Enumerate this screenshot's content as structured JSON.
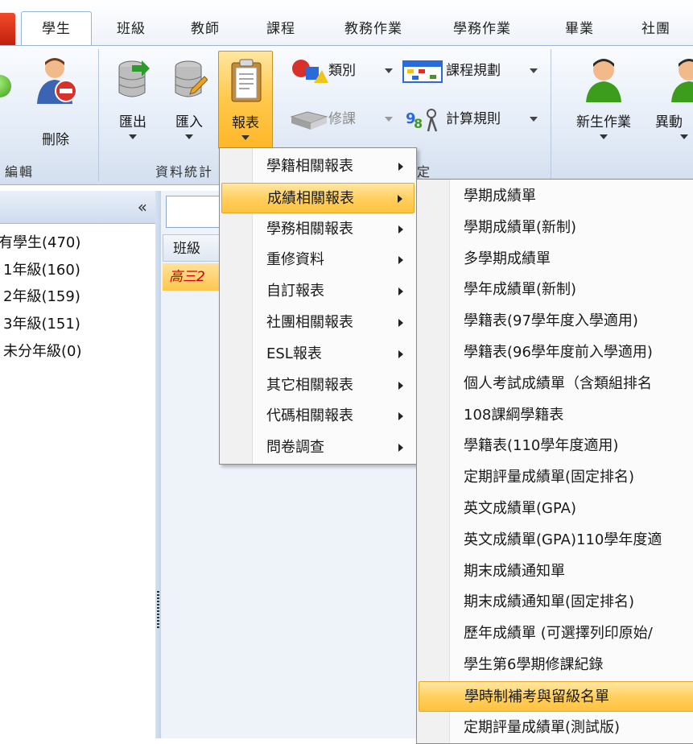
{
  "tabs": [
    "學生",
    "班級",
    "教師",
    "課程",
    "教務作業",
    "學務作業",
    "畢業",
    "社團"
  ],
  "active_tab": "學生",
  "ribbon": {
    "groups": {
      "edit": "編輯",
      "data": "資料統計",
      "settings": "定"
    },
    "buttons": {
      "delete": "刪除",
      "export": "匯出",
      "import": "匯入",
      "report": "報表",
      "category": "類別",
      "course_plan": "課程規劃",
      "enroll": "修課",
      "calc_rule": "計算規則",
      "new_student": "新生作業",
      "change": "異動"
    }
  },
  "left_panel": {
    "collapse_glyph": "«",
    "tree": [
      "有學生(470)",
      "1年級(160)",
      "2年級(159)",
      "3年級(151)",
      "未分年級(0)"
    ]
  },
  "grid": {
    "header": "班級",
    "row_value": "高三2"
  },
  "menu_reports": [
    "學籍相關報表",
    "成績相關報表",
    "學務相關報表",
    "重修資料",
    "自訂報表",
    "社團相關報表",
    "ESL報表",
    "其它相關報表",
    "代碼相關報表",
    "問卷調查"
  ],
  "menu_reports_highlight": 1,
  "menu_grades": [
    "學期成績單",
    "學期成績單(新制)",
    "多學期成績單",
    "學年成績單(新制)",
    "學籍表(97學年度入學適用)",
    "學籍表(96學年度前入學適用)",
    "個人考試成績單（含類組排名",
    "108課綱學籍表",
    "學籍表(110學年度適用)",
    "定期評量成績單(固定排名)",
    "英文成績單(GPA)",
    "英文成績單(GPA)110學年度適",
    "期末成績通知單",
    "期末成績通知單(固定排名)",
    "歷年成績單 (可選擇列印原始/",
    "學生第6學期修課紀錄",
    "學時制補考與留級名單",
    "定期評量成績單(測試版)"
  ],
  "menu_grades_highlight": 16
}
